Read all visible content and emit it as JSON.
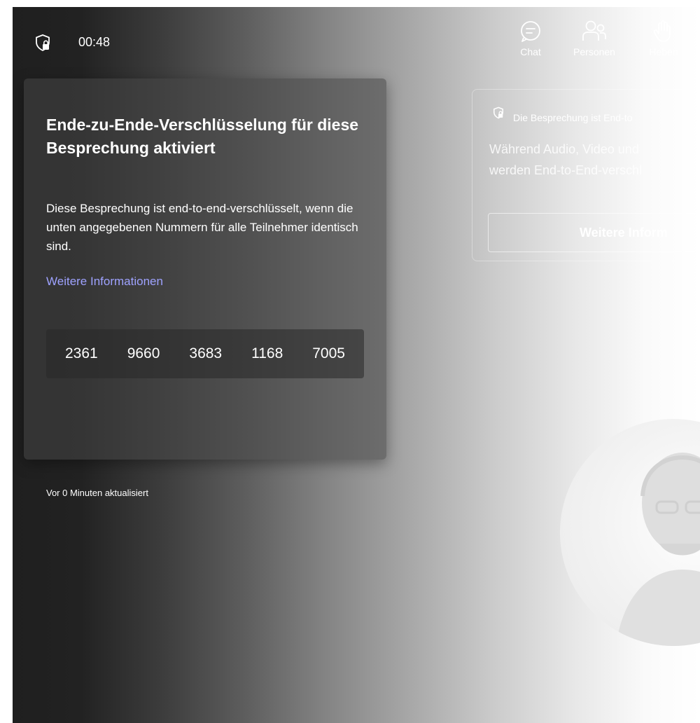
{
  "header": {
    "timer": "00:48",
    "toolbar": [
      {
        "label": "Chat",
        "icon": "chat-icon"
      },
      {
        "label": "Personen",
        "icon": "people-icon"
      },
      {
        "label": "Heben",
        "icon": "raise-hand-icon"
      }
    ]
  },
  "encryption_popup": {
    "title": "Ende-zu-Ende-Verschlüsselung für diese Besprechung aktiviert",
    "description": "Diese Besprechung ist end-to-end-verschlüsselt, wenn die unten angegebenen Nummern für alle Teilnehmer identisch sind.",
    "link": "Weitere Informationen",
    "codes": [
      "2361",
      "9660",
      "3683",
      "1168",
      "7005"
    ],
    "updated": "Vor 0 Minuten aktualisiert"
  },
  "banner": {
    "title": "Die Besprechung ist End-to",
    "text_line1": "Während Audio, Video und",
    "text_line2": "werden End-to-End-verschl",
    "button_label": "Weitere Inform"
  },
  "colors": {
    "link": "#9ea2ff",
    "popup_bg": "#464646",
    "text": "#ffffff"
  }
}
